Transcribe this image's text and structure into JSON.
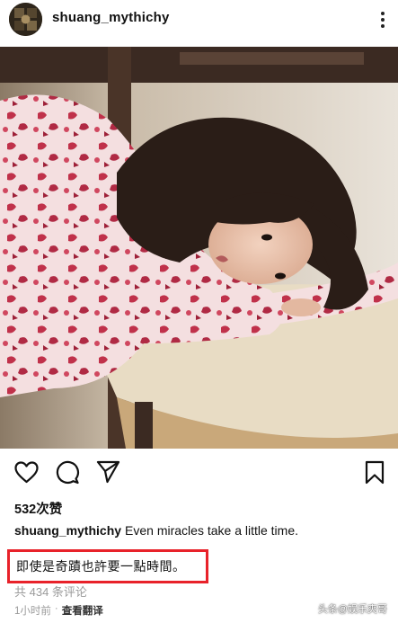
{
  "post": {
    "username": "shuang_mythichy",
    "likes": "532次赞",
    "caption_user": "shuang_mythichy",
    "caption_text": "Even miracles take a little time.",
    "translation": "即使是奇蹟也許要一點時間。",
    "comments": "共 434 条评论",
    "time": "1小时前",
    "separator": "·",
    "see_translation": "查看翻译"
  },
  "watermark": "头条@娱乐爽哥",
  "icons": {
    "more": "more-dots-icon",
    "like": "heart-icon",
    "comment": "comment-icon",
    "share": "send-icon",
    "save": "bookmark-icon"
  },
  "colors": {
    "highlight_border": "#e8222a",
    "muted_text": "#9a9a9a"
  }
}
